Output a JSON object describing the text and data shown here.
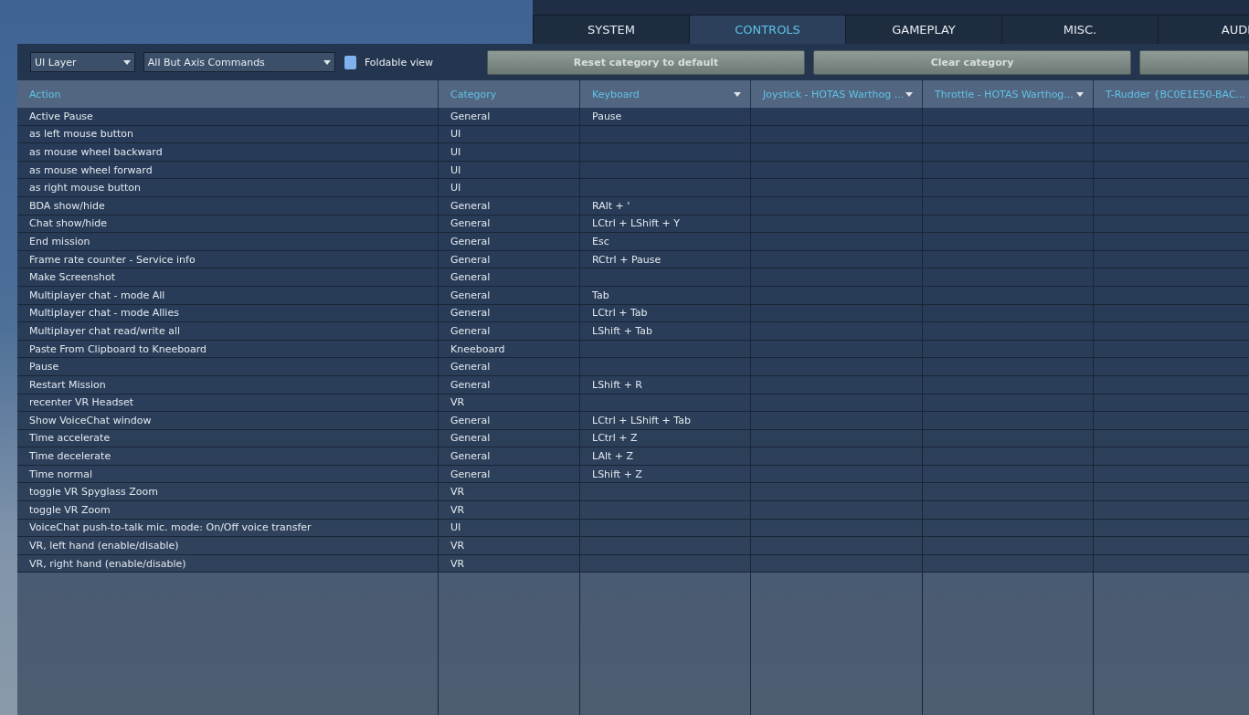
{
  "tabs": [
    {
      "label": "SYSTEM",
      "selected": false
    },
    {
      "label": "CONTROLS",
      "selected": true
    },
    {
      "label": "GAMEPLAY",
      "selected": false
    },
    {
      "label": "MISC.",
      "selected": false
    },
    {
      "label": "AUDI",
      "selected": false
    }
  ],
  "toolbar": {
    "aircraft": "UI Layer",
    "filter": "All But Axis Commands",
    "foldable_view": {
      "label": "Foldable view",
      "checked": false
    },
    "buttons": [
      "Reset category to default",
      "Clear category"
    ]
  },
  "table": {
    "columns": [
      {
        "label": "Action",
        "dropdown": false
      },
      {
        "label": "Category",
        "dropdown": false
      },
      {
        "label": "Keyboard",
        "dropdown": true
      },
      {
        "label": "Joystick - HOTAS Warthog ...",
        "dropdown": true
      },
      {
        "label": "Throttle - HOTAS Warthog...",
        "dropdown": true
      },
      {
        "label": "T-Rudder {BC0E1E50-BAC..."
      }
    ],
    "rows": [
      {
        "action": "Active Pause",
        "category": "General",
        "keyboard": "Pause"
      },
      {
        "action": "as left mouse button",
        "category": "UI"
      },
      {
        "action": "as mouse wheel backward",
        "category": "UI"
      },
      {
        "action": "as mouse wheel forward",
        "category": "UI"
      },
      {
        "action": "as right mouse button",
        "category": "UI"
      },
      {
        "action": "BDA show/hide",
        "category": "General",
        "keyboard": "RAlt + '"
      },
      {
        "action": "Chat show/hide",
        "category": "General",
        "keyboard": "LCtrl + LShift + Y"
      },
      {
        "action": "End mission",
        "category": "General",
        "keyboard": "Esc"
      },
      {
        "action": "Frame rate counter - Service info",
        "category": "General",
        "keyboard": "RCtrl + Pause"
      },
      {
        "action": "Make Screenshot",
        "category": "General"
      },
      {
        "action": "Multiplayer chat - mode All",
        "category": "General",
        "keyboard": "Tab"
      },
      {
        "action": "Multiplayer chat - mode Allies",
        "category": "General",
        "keyboard": "LCtrl + Tab"
      },
      {
        "action": "Multiplayer chat read/write all",
        "category": "General",
        "keyboard": "LShift + Tab"
      },
      {
        "action": "Paste From Clipboard to Kneeboard",
        "category": "Kneeboard"
      },
      {
        "action": "Pause",
        "category": "General"
      },
      {
        "action": "Restart Mission",
        "category": "General",
        "keyboard": "LShift + R"
      },
      {
        "action": "recenter VR Headset",
        "category": "VR"
      },
      {
        "action": "Show VoiceChat window",
        "category": "General",
        "keyboard": "LCtrl + LShift + Tab"
      },
      {
        "action": "Time accelerate",
        "category": "General",
        "keyboard": "LCtrl + Z"
      },
      {
        "action": "Time decelerate",
        "category": "General",
        "keyboard": "LAlt + Z"
      },
      {
        "action": "Time normal",
        "category": "General",
        "keyboard": "LShift + Z"
      },
      {
        "action": "toggle VR Spyglass Zoom",
        "category": "VR"
      },
      {
        "action": "toggle VR Zoom",
        "category": "VR"
      },
      {
        "action": "VoiceChat push-to-talk mic. mode: On/Off voice transfer",
        "category": "UI"
      },
      {
        "action": "VR, left hand (enable/disable)",
        "category": "VR"
      },
      {
        "action": "VR, right hand (enable/disable)",
        "category": "VR"
      }
    ]
  }
}
